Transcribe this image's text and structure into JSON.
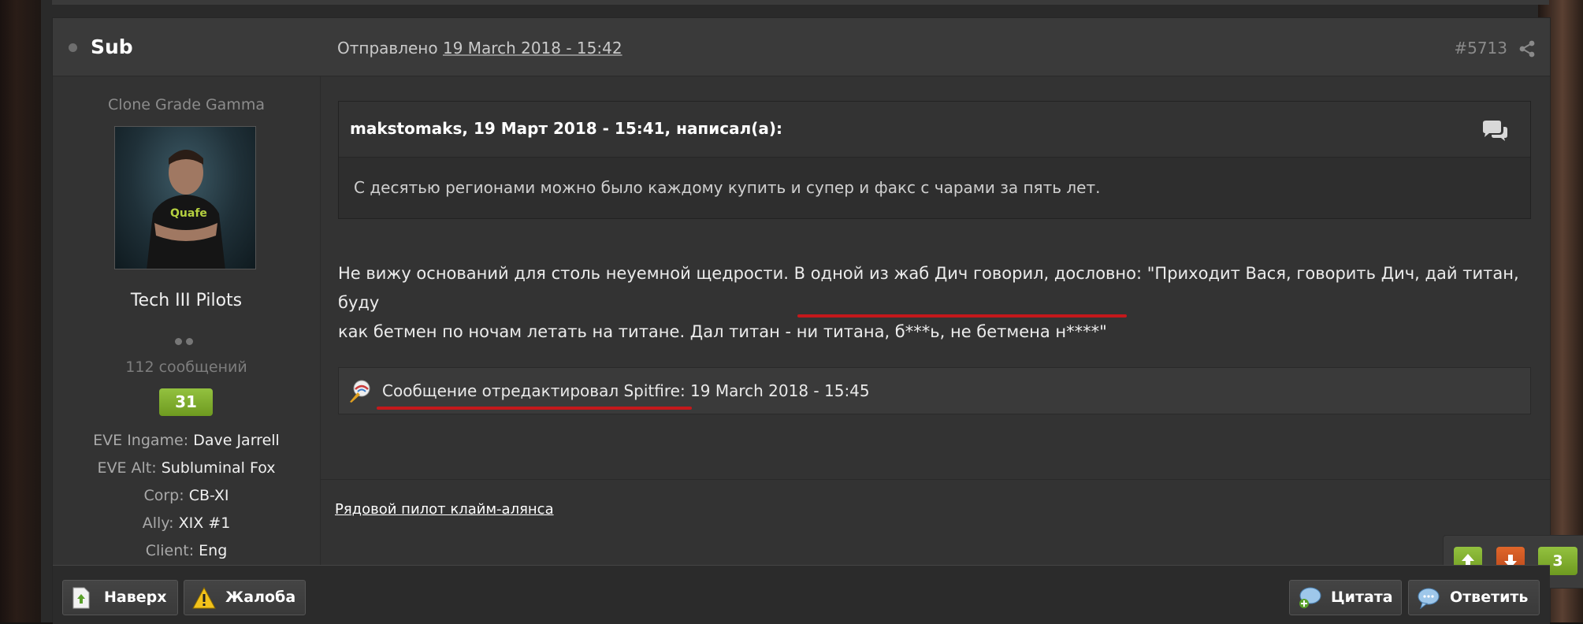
{
  "post": {
    "author": "Sub",
    "posted_prefix": "Отправлено",
    "posted_date": "19 March 2018 - 15:42",
    "post_number": "#5713"
  },
  "author_info": {
    "rank_title": "Clone Grade Gamma",
    "group": "Tech III Pilots",
    "post_count": "112 сообщений",
    "reputation": "31",
    "fields": [
      {
        "label": "EVE Ingame:",
        "value": "Dave Jarrell"
      },
      {
        "label": "EVE Alt:",
        "value": "Subluminal Fox"
      },
      {
        "label": "Corp:",
        "value": "CB-XI"
      },
      {
        "label": "Ally:",
        "value": "XIX #1"
      },
      {
        "label": "Client:",
        "value": "Eng"
      }
    ]
  },
  "quote": {
    "citation": "makstomaks, 19 Март 2018 - 15:41, написал(а):",
    "text": "С десятью регионами можно было каждому купить и супер и факс с чарами за пять лет."
  },
  "body": {
    "line1": "Не вижу оснований для столь неуемной щедрости. В одной из жаб Дич говорил, дословно: \"Приходит Вася, говорить Дич, дай титан, буду",
    "line2": "как бетмен по ночам летать на титане. Дал титан - ни титана, б***ь, не бетмена н****\""
  },
  "edit_note": "Сообщение отредактировал Spitfire: 19 March 2018 - 15:45",
  "signature": "Рядовой пилот клайм-алянса",
  "votes": {
    "count": "3"
  },
  "footer": {
    "top_label": "Наверх",
    "report_label": "Жалоба",
    "quote_label": "Цитата",
    "reply_label": "Ответить"
  },
  "colors": {
    "accent_green": "#7fae2e",
    "vote_down": "#d2572a",
    "highlight_red": "#c4181b"
  }
}
